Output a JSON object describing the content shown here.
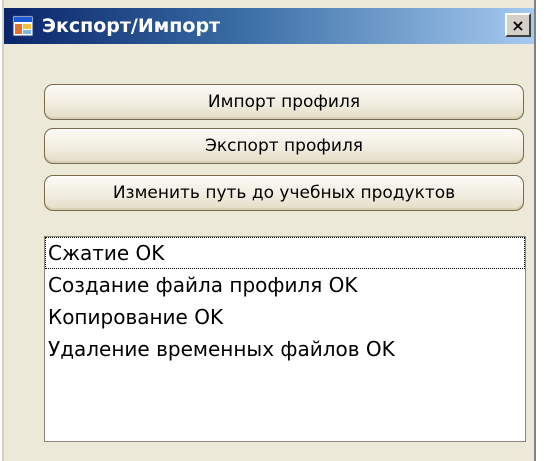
{
  "window": {
    "title": "Экспорт/Импорт",
    "close_glyph": "×",
    "icon": "app-window-icon"
  },
  "buttons": {
    "import_label": "Импорт профиля",
    "export_label": "Экспорт профиля",
    "change_path_label": "Изменить путь до учебных продуктов"
  },
  "log": {
    "items": [
      "Сжатие OK",
      "Создание файла профиля OK",
      "Копирование OK",
      "Удаление временных файлов OK"
    ]
  },
  "colors": {
    "titlebar_start": "#0a246a",
    "titlebar_end": "#a6caf0",
    "window_face": "#ece9d8"
  }
}
